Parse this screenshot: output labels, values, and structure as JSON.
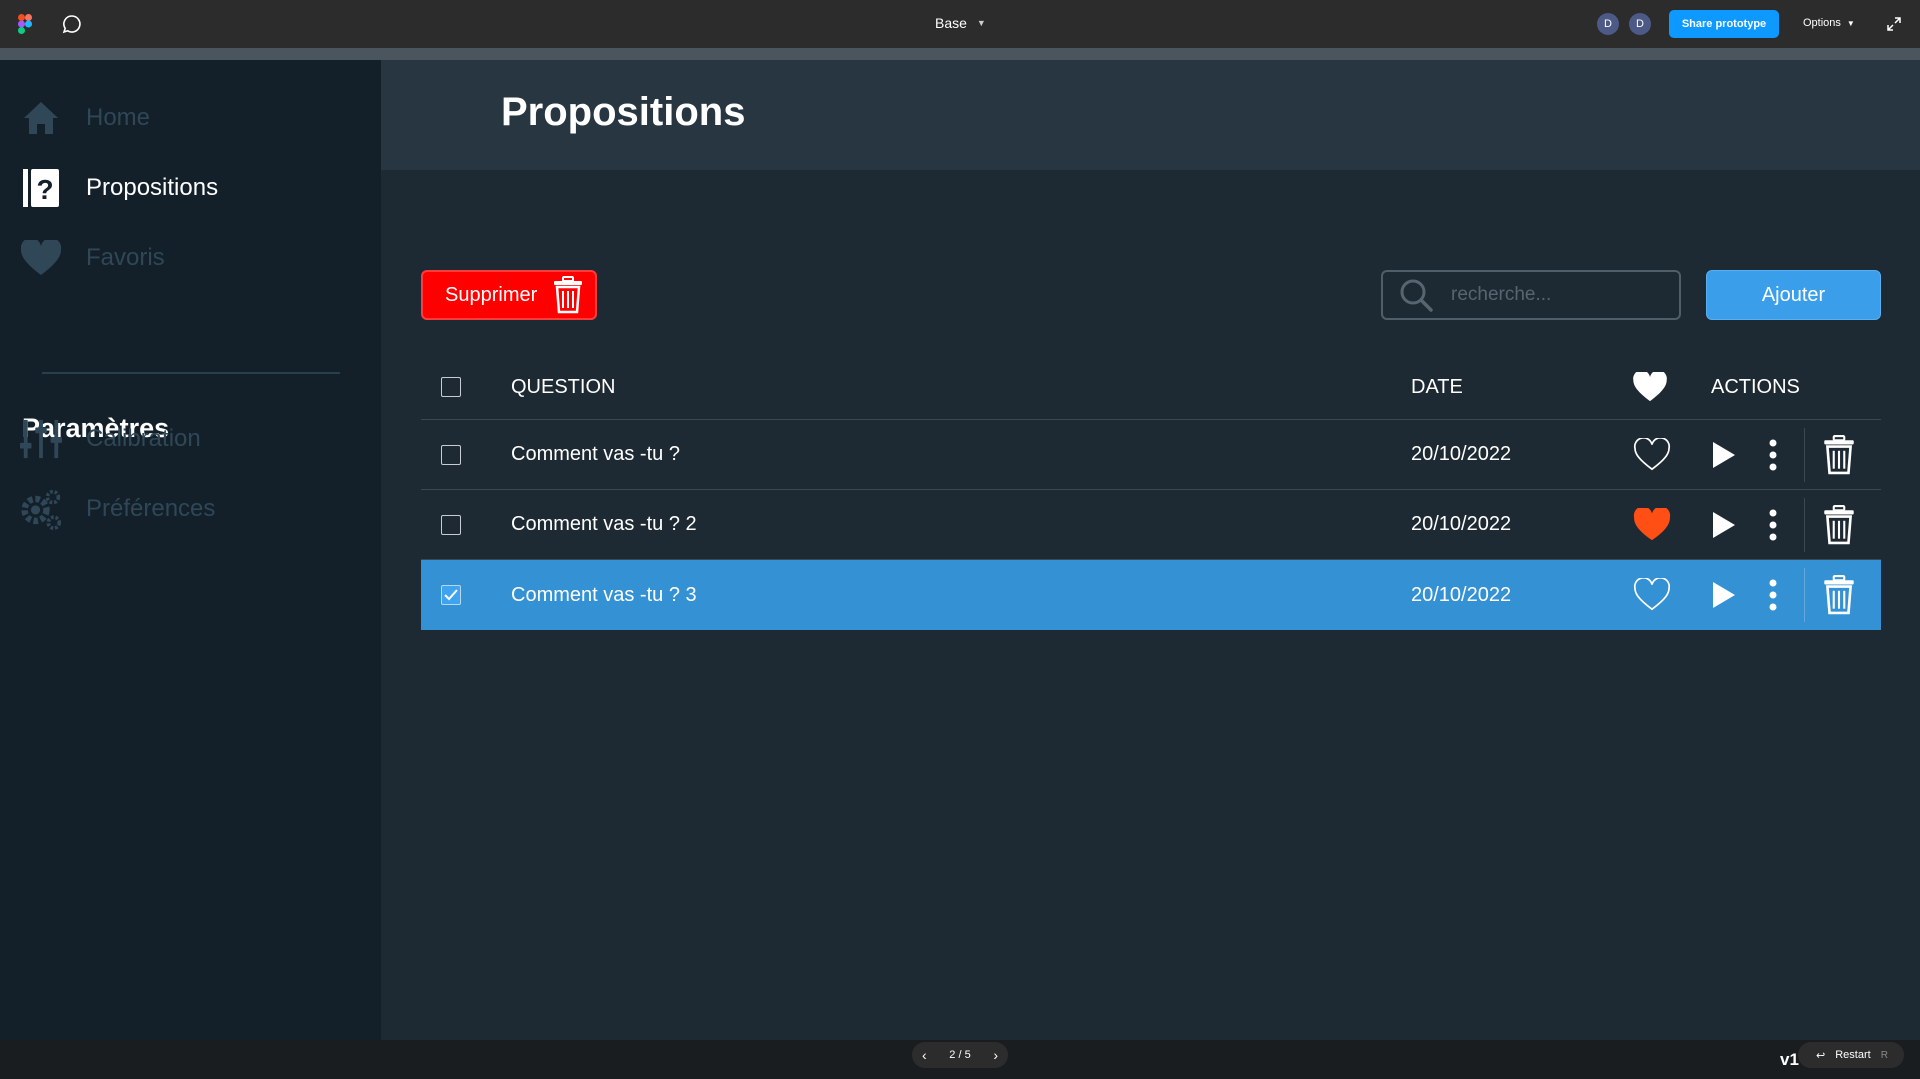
{
  "figma": {
    "file_title": "Base",
    "avatars": [
      "D",
      "D"
    ],
    "share_label": "Share prototype",
    "options_label": "Options",
    "pager": "2 / 5",
    "restart_label": "Restart",
    "restart_key": "R",
    "version": "v1"
  },
  "sidebar": {
    "items": [
      {
        "label": "Home",
        "icon": "home-icon"
      },
      {
        "label": "Propositions",
        "icon": "question-book-icon"
      },
      {
        "label": "Favoris",
        "icon": "heart-icon"
      }
    ],
    "settings_title": "Paramètres",
    "settings_items": [
      {
        "label": "Calibration",
        "icon": "sliders-icon"
      },
      {
        "label": "Préférences",
        "icon": "gears-icon"
      }
    ]
  },
  "page": {
    "title": "Propositions",
    "delete_label": "Supprimer",
    "search_placeholder": "recherche...",
    "add_label": "Ajouter"
  },
  "table": {
    "headers": {
      "question": "QUESTION",
      "date": "DATE",
      "actions": "ACTIONS"
    },
    "rows": [
      {
        "question": "Comment vas -tu ?",
        "date": "20/10/2022",
        "favorite": false,
        "selected": false
      },
      {
        "question": "Comment vas -tu ? 2",
        "date": "20/10/2022",
        "favorite": true,
        "selected": false
      },
      {
        "question": "Comment vas -tu ? 3",
        "date": "20/10/2022",
        "favorite": false,
        "selected": true
      }
    ]
  },
  "colors": {
    "accent_blue": "#3a9eea",
    "delete_red": "#ff0000",
    "favorite_orange": "#ff4f14",
    "selected_row": "#3391d4"
  }
}
